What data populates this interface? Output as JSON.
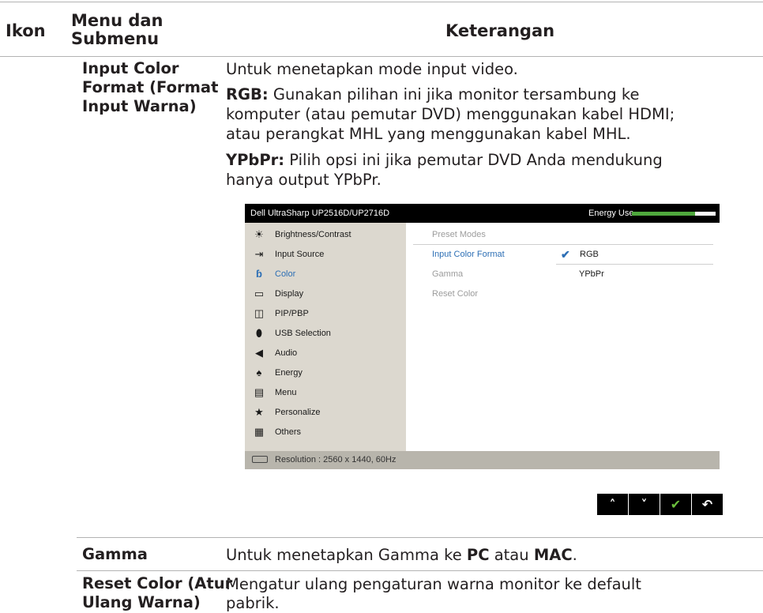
{
  "header": {
    "col_icon": "Ikon",
    "col_menu_line1": "Menu dan",
    "col_menu_line2": "Submenu",
    "col_desc": "Keterangan"
  },
  "rows": {
    "input_color_format": {
      "name_line1": "Input Color",
      "name_line2": "Format (Format",
      "name_line3": "Input Warna)",
      "intro": "Untuk menetapkan mode input video.",
      "rgb_label": "RGB:",
      "rgb_line1": " Gunakan pilihan ini jika monitor tersambung ke",
      "rgb_line2": "komputer (atau pemutar DVD) menggunakan kabel HDMI;",
      "rgb_line3": "atau perangkat MHL yang menggunakan kabel MHL.",
      "ypbpr_label": "YPbPr:",
      "ypbpr_line1": " Pilih opsi ini jika pemutar DVD Anda mendukung",
      "ypbpr_line2": "hanya output YPbPr."
    },
    "gamma": {
      "name": "Gamma",
      "desc_a": "Untuk menetapkan Gamma ke ",
      "desc_pc": "PC",
      "desc_b": " atau ",
      "desc_mac": "MAC",
      "desc_c": "."
    },
    "reset_color": {
      "name_line1": "Reset Color (Atur",
      "name_line2": "Ulang Warna)",
      "desc_line1": "Mengatur ulang pengaturan warna monitor ke default",
      "desc_line2": "pabrik."
    }
  },
  "osd": {
    "title": "Dell UltraSharp UP2516D/UP2716D",
    "energy_label": "Energy Use",
    "energy_level": 0.75,
    "menu": [
      {
        "label": "Brightness/Contrast",
        "icon": "sun-icon"
      },
      {
        "label": "Input Source",
        "icon": "input-icon"
      },
      {
        "label": "Color",
        "icon": "color-icon"
      },
      {
        "label": "Display",
        "icon": "monitor-icon"
      },
      {
        "label": "PIP/PBP",
        "icon": "pip-icon"
      },
      {
        "label": "USB Selection",
        "icon": "usb-icon"
      },
      {
        "label": "Audio",
        "icon": "speaker-icon"
      },
      {
        "label": "Energy",
        "icon": "energy-icon"
      },
      {
        "label": "Menu",
        "icon": "menu-icon"
      },
      {
        "label": "Personalize",
        "icon": "star-icon"
      },
      {
        "label": "Others",
        "icon": "others-icon"
      }
    ],
    "active_menu": "Color",
    "submenu": [
      {
        "label": "Preset Modes"
      },
      {
        "label": "Input Color Format",
        "option": "RGB"
      },
      {
        "label": "Gamma",
        "option": "YPbPr"
      },
      {
        "label": "Reset Color"
      }
    ],
    "resolution": "Resolution : 2560 x 1440, 60Hz"
  },
  "nav_buttons": [
    "up-icon",
    "down-icon",
    "check-icon",
    "back-icon"
  ]
}
